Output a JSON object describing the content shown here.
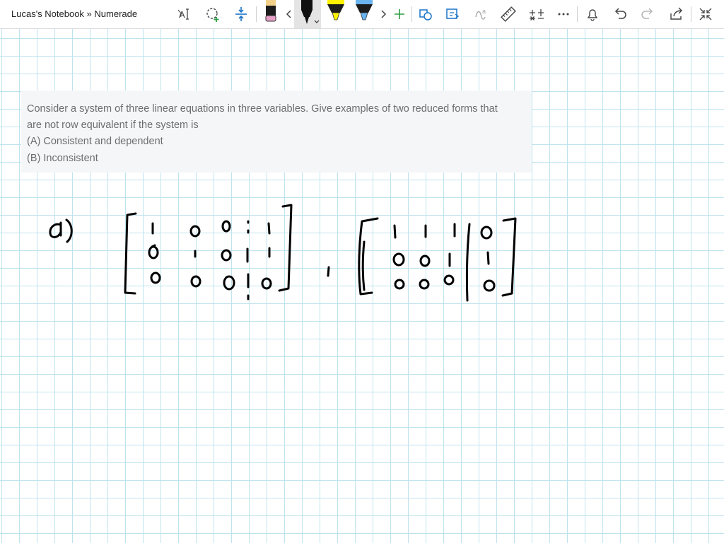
{
  "app": {
    "title": "Lucas's Notebook » Numerade"
  },
  "toolbar": {
    "tools": [
      {
        "name": "text-select-tool",
        "icon": "text-cursor-icon"
      },
      {
        "name": "lasso-select-tool",
        "icon": "lasso-plus-icon"
      },
      {
        "name": "insert-space-tool",
        "icon": "insert-space-icon"
      },
      {
        "name": "pen-pink",
        "icon": "pen-icon",
        "color": "#e8a0c8"
      },
      {
        "name": "scroll-left",
        "icon": "chevron-left-icon"
      },
      {
        "name": "pen-black",
        "icon": "pen-icon",
        "color": "#000000",
        "selected": true
      },
      {
        "name": "highlighter-yellow",
        "icon": "highlighter-icon",
        "color": "#fff200"
      },
      {
        "name": "highlighter-blue",
        "icon": "highlighter-icon",
        "color": "#6ab4f0"
      },
      {
        "name": "scroll-right",
        "icon": "chevron-right-icon"
      },
      {
        "name": "add-pen",
        "icon": "plus-icon"
      },
      {
        "name": "ink-to-shape",
        "icon": "shapes-icon"
      },
      {
        "name": "ink-to-text",
        "icon": "convert-icon"
      },
      {
        "name": "ink-to-math",
        "icon": "math-icon"
      },
      {
        "name": "ruler",
        "icon": "ruler-icon"
      },
      {
        "name": "math-tool",
        "icon": "math-symbols-icon"
      },
      {
        "name": "more-options",
        "icon": "ellipsis-icon"
      },
      {
        "name": "notifications",
        "icon": "bell-icon"
      },
      {
        "name": "undo",
        "icon": "undo-icon"
      },
      {
        "name": "redo",
        "icon": "redo-icon",
        "disabled": true
      },
      {
        "name": "share",
        "icon": "share-icon"
      },
      {
        "name": "full-screen",
        "icon": "collapse-icon"
      }
    ]
  },
  "question": {
    "line1": "Consider a system of three linear equations in three variables. Give examples of two reduced forms that",
    "line2": "are not row equivalent if the system is",
    "option_a": "(A) Consistent and dependent",
    "option_b": "(B) Inconsistent"
  },
  "colors": {
    "grid": "#bfe3ee",
    "ink": "#000000",
    "accent_green": "#2e9e44",
    "accent_blue": "#1a73c8",
    "question_bg": "#f4f6f8",
    "question_text": "#6d6d6d"
  }
}
